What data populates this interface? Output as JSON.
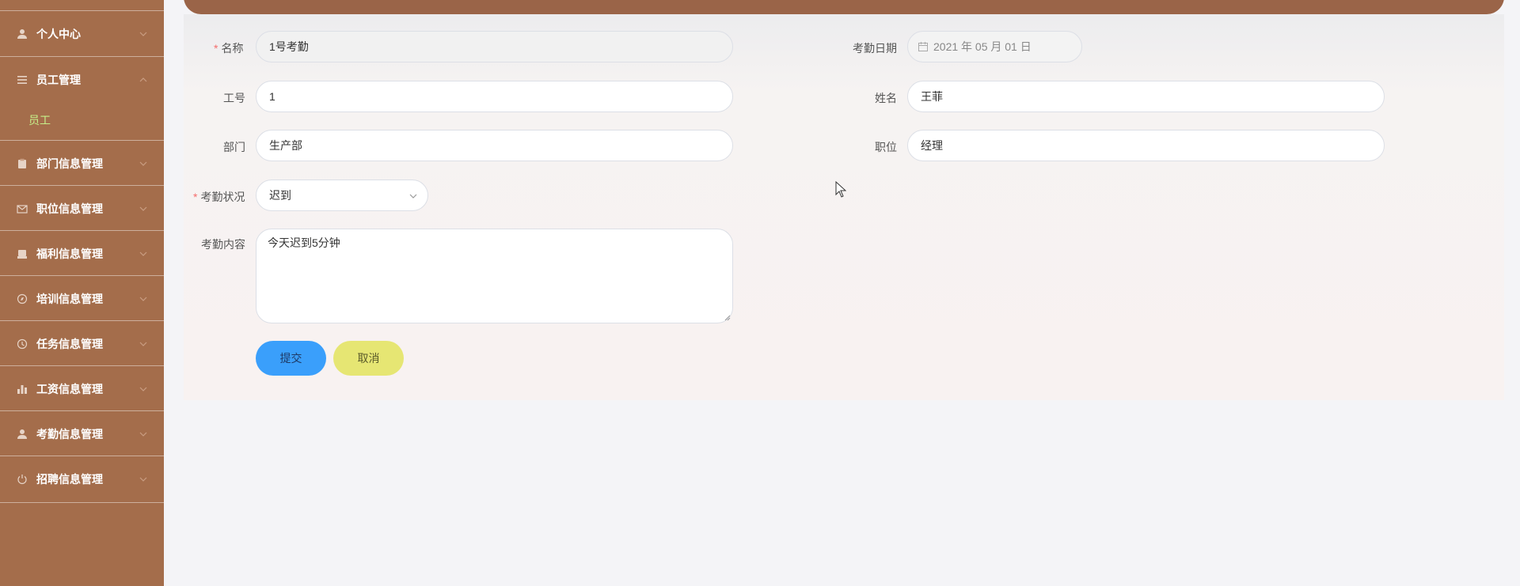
{
  "sidebar": {
    "items": [
      {
        "label": "个人中心",
        "icon": "user-icon"
      },
      {
        "label": "员工管理",
        "icon": "list-icon"
      },
      {
        "label": "部门信息管理",
        "icon": "clipboard-icon"
      },
      {
        "label": "职位信息管理",
        "icon": "mail-icon"
      },
      {
        "label": "福利信息管理",
        "icon": "printer-icon"
      },
      {
        "label": "培训信息管理",
        "icon": "compass-icon"
      },
      {
        "label": "任务信息管理",
        "icon": "clock-icon"
      },
      {
        "label": "工资信息管理",
        "icon": "bar-chart-icon"
      },
      {
        "label": "考勤信息管理",
        "icon": "user-icon"
      },
      {
        "label": "招聘信息管理",
        "icon": "power-icon"
      }
    ],
    "sub_item": "员工"
  },
  "form": {
    "name_label": "名称",
    "name_value": "1号考勤",
    "date_label": "考勤日期",
    "date_value": "2021 年 05 月 01 日",
    "empno_label": "工号",
    "empno_value": "1",
    "empname_label": "姓名",
    "empname_value": "王菲",
    "dept_label": "部门",
    "dept_value": "生产部",
    "position_label": "职位",
    "position_value": "经理",
    "status_label": "考勤状况",
    "status_value": "迟到",
    "content_label": "考勤内容",
    "content_value": "今天迟到5分钟",
    "required_mark": "*"
  },
  "buttons": {
    "submit": "提交",
    "cancel": "取消"
  },
  "colors": {
    "sidebar_bg": "#a46d4b",
    "sub_item": "#c6f08a",
    "submit_bg": "#3a9ffb",
    "cancel_bg": "#e6e673",
    "required": "#f56c6c"
  }
}
